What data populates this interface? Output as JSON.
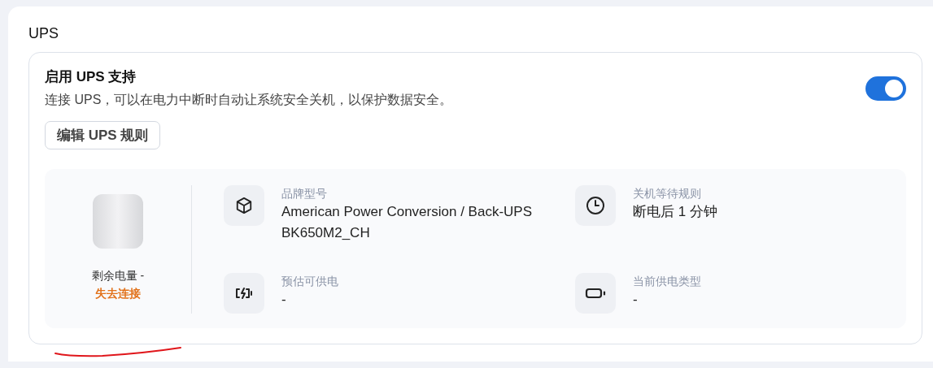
{
  "section": {
    "title": "UPS"
  },
  "setting": {
    "title": "启用 UPS 支持",
    "description": "连接 UPS，可以在电力中断时自动让系统安全关机，以保护数据安全。",
    "on": true
  },
  "edit_button": "编辑 UPS 规则",
  "status": {
    "battery_label": "剩余电量 -",
    "connection": "失去连接"
  },
  "info": [
    {
      "kind": "model",
      "label": "品牌型号",
      "value": "American Power Conversion / Back-UPS BK650M2_CH"
    },
    {
      "kind": "timer",
      "label": "关机等待规则",
      "value": "断电后 1 分钟"
    },
    {
      "kind": "runtime",
      "label": "预估可供电",
      "value": "-"
    },
    {
      "kind": "power",
      "label": "当前供电类型",
      "value": "-"
    }
  ],
  "annotation": {
    "kind": "underline"
  }
}
